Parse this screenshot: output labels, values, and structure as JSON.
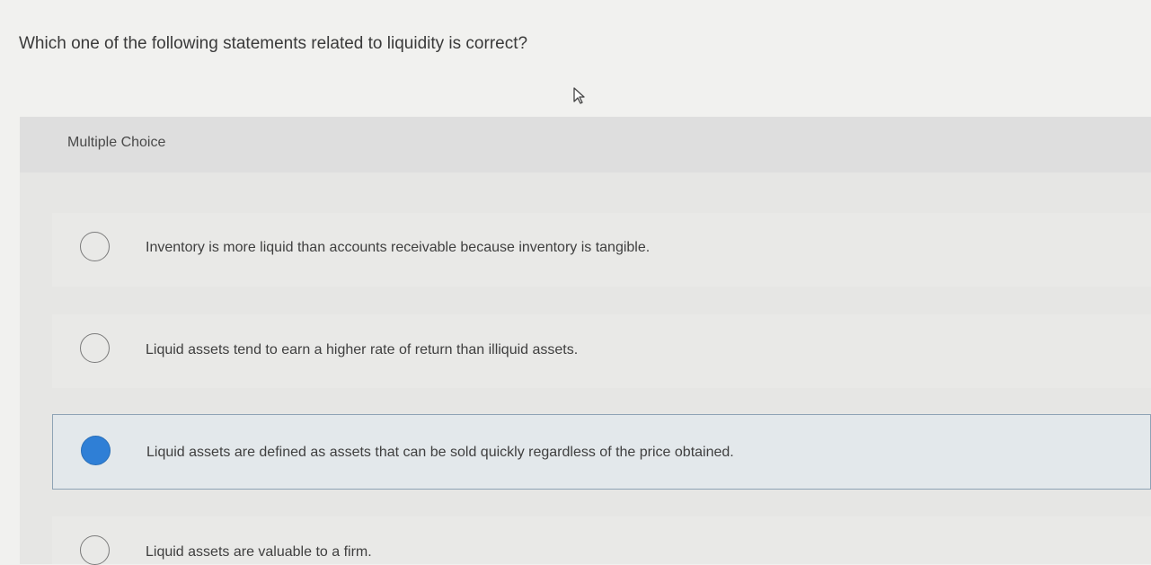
{
  "question": {
    "text": "Which one of the following statements related to liquidity is correct?"
  },
  "panel": {
    "title": "Multiple Choice"
  },
  "options": [
    {
      "label": "Inventory is more liquid than accounts receivable because inventory is tangible.",
      "selected": false
    },
    {
      "label": "Liquid assets tend to earn a higher rate of return than illiquid assets.",
      "selected": false
    },
    {
      "label": "Liquid assets are defined as assets that can be sold quickly regardless of the price obtained.",
      "selected": true
    },
    {
      "label": "Liquid assets are valuable to a firm.",
      "selected": false
    }
  ],
  "colors": {
    "selected_radio": "#2f7fd6",
    "selected_border": "#8ea3b5"
  },
  "icons": {
    "cursor": "mouse-pointer-icon"
  }
}
